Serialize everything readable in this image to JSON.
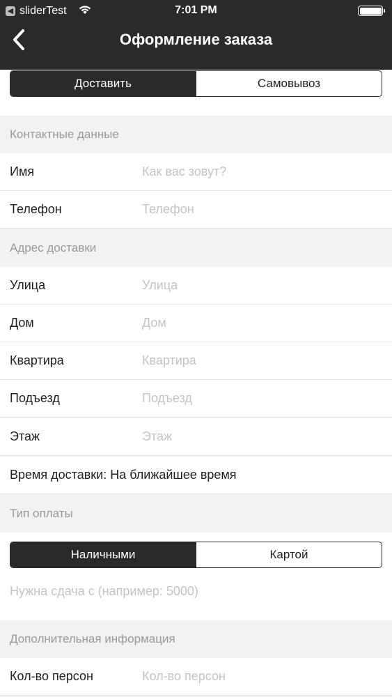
{
  "status_bar": {
    "app_name": "sliderTest",
    "time": "7:01 PM"
  },
  "nav": {
    "title": "Оформление заказа"
  },
  "delivery_mode": {
    "options": [
      "Доставить",
      "Самовывоз"
    ],
    "selected": "Доставить"
  },
  "contact": {
    "header": "Контактные данные",
    "name": {
      "label": "Имя",
      "placeholder": "Как вас зовут?"
    },
    "phone": {
      "label": "Телефон",
      "placeholder": "Телефон"
    }
  },
  "address": {
    "header": "Адрес доставки",
    "street": {
      "label": "Улица",
      "placeholder": "Улица"
    },
    "house": {
      "label": "Дом",
      "placeholder": "Дом"
    },
    "apartment": {
      "label": "Квартира",
      "placeholder": "Квартира"
    },
    "entrance": {
      "label": "Подъезд",
      "placeholder": "Подъезд"
    },
    "floor": {
      "label": "Этаж",
      "placeholder": "Этаж"
    },
    "delivery_time": "Время доставки: На ближайшее время"
  },
  "payment": {
    "header": "Тип оплаты",
    "options": [
      "Наличными",
      "Картой"
    ],
    "selected": "Наличными",
    "change_placeholder": "Нужна сдача с (например: 5000)"
  },
  "extra": {
    "header": "Дополнительная информация",
    "persons": {
      "label": "Кол-во персон",
      "placeholder": "Кол-во персон"
    }
  },
  "colors": {
    "bar": "#2b2a29",
    "section_bg": "#f2f2f2",
    "placeholder": "#c4c4c4"
  }
}
